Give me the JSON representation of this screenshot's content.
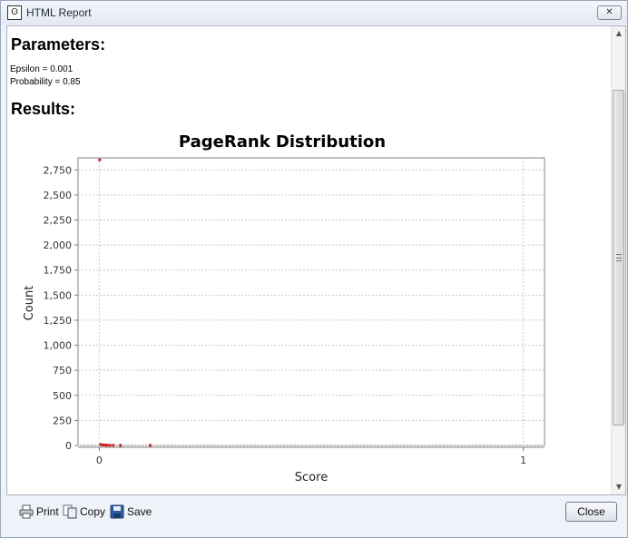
{
  "window": {
    "title": "HTML Report",
    "close_label": "✕"
  },
  "report": {
    "parameters_heading": "Parameters:",
    "parameters": [
      "Epsilon = 0.001",
      "Probability = 0.85"
    ],
    "results_heading": "Results:"
  },
  "chart_data": {
    "type": "scatter",
    "title": "PageRank Distribution",
    "xlabel": "Score",
    "ylabel": "Count",
    "xlim": [
      -0.05,
      1.05
    ],
    "ylim": [
      0,
      2870
    ],
    "x_ticks": [
      0,
      1
    ],
    "x_tick_labels": [
      "0",
      "1"
    ],
    "y_ticks": [
      0,
      250,
      500,
      750,
      1000,
      1250,
      1500,
      1750,
      2000,
      2250,
      2500,
      2750
    ],
    "y_tick_labels": [
      "0",
      "250",
      "500",
      "750",
      "1,000",
      "1,250",
      "1,500",
      "1,750",
      "2,000",
      "2,250",
      "2,500",
      "2,750"
    ],
    "grid": true,
    "point_color": "#cc2222",
    "series": [
      {
        "x": [
          0.001,
          0.003,
          0.006,
          0.01,
          0.014,
          0.018,
          0.025,
          0.033,
          0.05,
          0.12
        ],
        "y": [
          2850,
          10,
          6,
          5,
          4,
          3,
          2,
          2,
          1,
          1
        ]
      }
    ]
  },
  "toolbar": {
    "print_label": "Print",
    "copy_label": "Copy",
    "save_label": "Save",
    "close_label": "Close"
  }
}
